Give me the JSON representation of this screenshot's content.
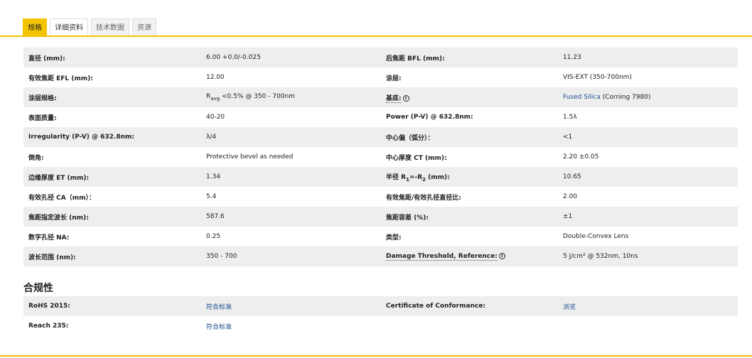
{
  "tabs": [
    {
      "label": "规格"
    },
    {
      "label": "详细资料"
    },
    {
      "label": "技术数据"
    },
    {
      "label": "资源"
    }
  ],
  "specs": [
    {
      "l1": "直径 (mm):",
      "v1": "6.00 +0.0/-0.025",
      "l2": "后焦距 BFL (mm):",
      "v2": "11.23"
    },
    {
      "l1": "有效焦距 EFL (mm):",
      "v1": "12.00",
      "l2": "涂层:",
      "v2": "VIS-EXT (350-700nm)"
    },
    {
      "l1": "涂层规格:",
      "v1_a": "R",
      "v1_sub": "avg",
      "v1_b": " <0.5% @ 350 - 700nm",
      "l2": "基底:",
      "v2": "Fused Silica",
      "v2_extra": " (Corning 7980)"
    },
    {
      "l1": "表面质量:",
      "v1": "40-20",
      "l2": "Power (P-V) @ 632.8nm:",
      "v2": "1.5λ"
    },
    {
      "l1": "Irregularity (P-V) @ 632.8nm:",
      "v1": "λ/4",
      "l2": "中心偏（弧分）：",
      "v2": "<1"
    },
    {
      "l1": "倒角:",
      "v1": "Protective bevel as needed",
      "l2": "中心厚度 CT (mm):",
      "v2": "2.20 ±0.05"
    },
    {
      "l1": "边缘厚度 ET (mm):",
      "v1": "1.34",
      "l2_a": "半径 R",
      "l2_s1": "1",
      "l2_b": "=-R",
      "l2_s2": "2",
      "l2_c": " (mm):",
      "v2": "10.65"
    },
    {
      "l1": "有效孔径 CA（mm）：",
      "v1": "5.4",
      "l2": "有效焦距/有效孔径直径比:",
      "v2": "2.00"
    },
    {
      "l1": "焦距指定波长 (nm):",
      "v1": "587.6",
      "l2": "焦距容差 (%):",
      "v2": "±1"
    },
    {
      "l1": "数字孔径 NA:",
      "v1": "0.25",
      "l2": "类型:",
      "v2": "Double-Convex Lens"
    },
    {
      "l1": "波长范围 (nm):",
      "v1": "350 - 700",
      "l2": "Damage Threshold, Reference:",
      "v2": "5 J/cm² @ 532nm, 10ns"
    }
  ],
  "compliance": {
    "title": "合规性",
    "rows": [
      {
        "l1": "RoHS 2015:",
        "v1": "符合标准",
        "l2": "Certificate of Conformance:",
        "v2": "浏览"
      },
      {
        "l1": "Reach 235:",
        "v1": "符合标准",
        "l2": "",
        "v2": ""
      }
    ]
  },
  "colors": {
    "accent": "#f5c400",
    "link": "#1f4f8f",
    "row_shade": "#eeeeee"
  }
}
